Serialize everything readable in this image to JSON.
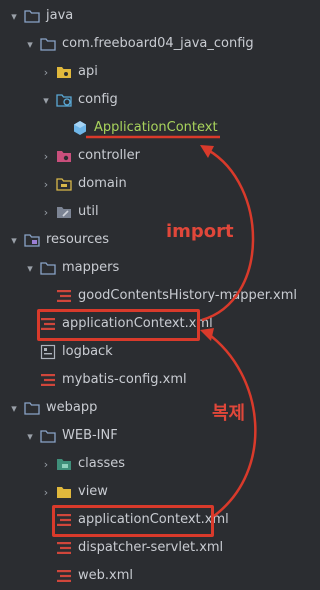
{
  "tree": {
    "java": {
      "label": "java",
      "icon": "folder-icon"
    },
    "pkg": {
      "label": "com.freeboard04_java_config",
      "icon": "folder-icon"
    },
    "api": {
      "label": "api",
      "icon": "package-folder-icon"
    },
    "config": {
      "label": "config",
      "icon": "config-folder-icon"
    },
    "appctx_class": {
      "label": "ApplicationContext",
      "icon": "java-class-icon"
    },
    "controller": {
      "label": "controller",
      "icon": "controller-folder-icon"
    },
    "domain": {
      "label": "domain",
      "icon": "domain-folder-icon"
    },
    "util": {
      "label": "util",
      "icon": "util-folder-icon"
    },
    "resources": {
      "label": "resources",
      "icon": "resources-folder-icon"
    },
    "mappers": {
      "label": "mappers",
      "icon": "folder-icon"
    },
    "good_mapper": {
      "label": "goodContentsHistory-mapper.xml",
      "icon": "xml-file-icon"
    },
    "res_appctx": {
      "label": "applicationContext.xml",
      "icon": "xml-file-icon"
    },
    "logback": {
      "label": "logback",
      "icon": "logback-file-icon"
    },
    "mybatis": {
      "label": "mybatis-config.xml",
      "icon": "xml-file-icon"
    },
    "webapp": {
      "label": "webapp",
      "icon": "folder-icon"
    },
    "webinf": {
      "label": "WEB-INF",
      "icon": "folder-icon"
    },
    "classes": {
      "label": "classes",
      "icon": "classes-folder-icon"
    },
    "view": {
      "label": "view",
      "icon": "view-folder-icon"
    },
    "webinf_appctx": {
      "label": "applicationContext.xml",
      "icon": "xml-file-icon"
    },
    "dispatcher": {
      "label": "dispatcher-servlet.xml",
      "icon": "xml-file-icon"
    },
    "webxml": {
      "label": "web.xml",
      "icon": "xml-file-icon"
    }
  },
  "annotations": {
    "import_label": "import",
    "copy_label": "복제"
  },
  "colors": {
    "background": "#2b2d31",
    "text": "#c9ccd2",
    "selected_text": "#a8d35c",
    "annotation_red": "#d93a2b",
    "xml_red": "#d0463b"
  }
}
